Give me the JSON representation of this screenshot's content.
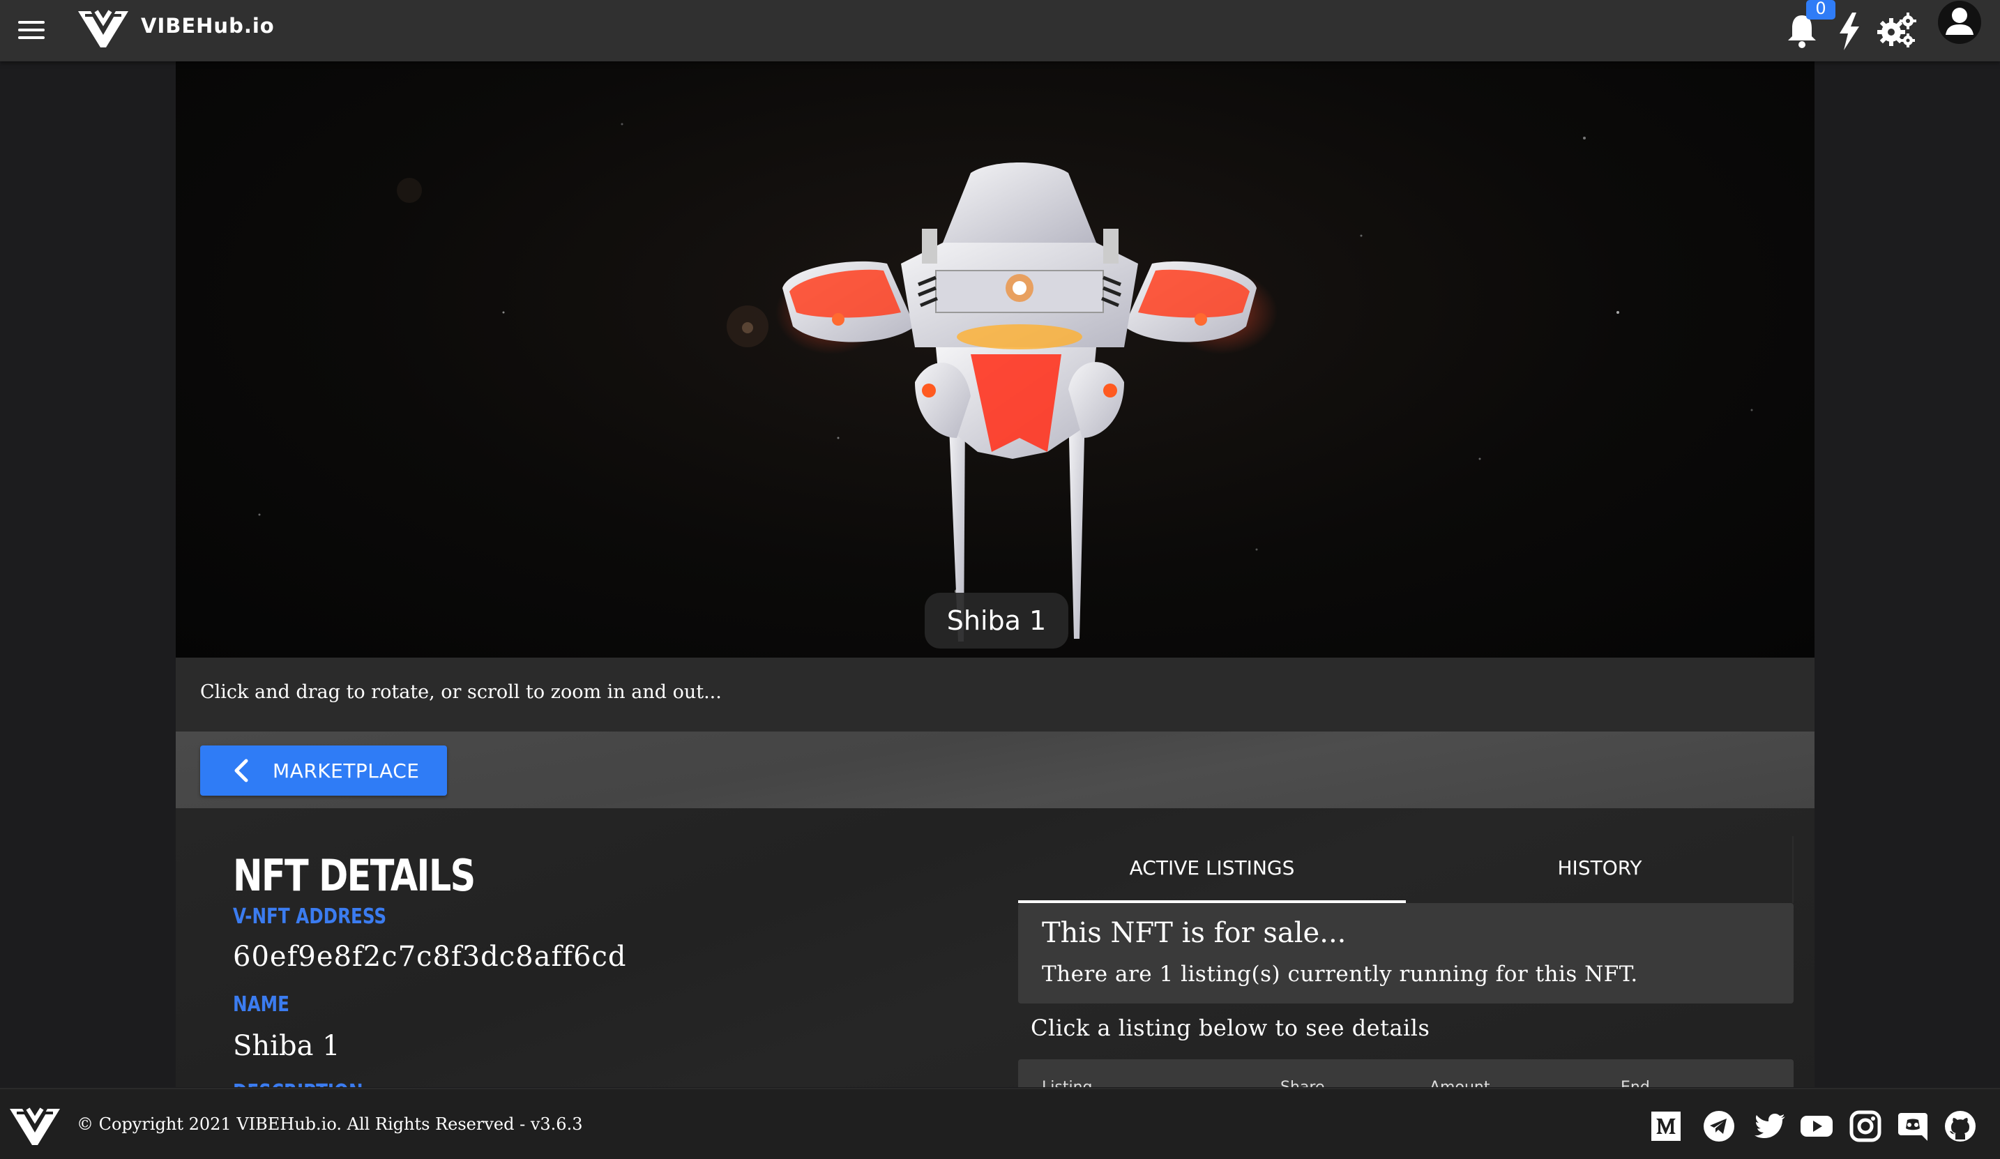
{
  "header": {
    "brand": "VIBEHub.io",
    "notification_count": "0",
    "icons": [
      "menu-icon",
      "bell-icon",
      "lightning-icon",
      "gear-icon",
      "user-icon"
    ]
  },
  "viewer": {
    "model_name": "Shiba 1",
    "hint": "Click and drag to rotate, or scroll to zoom in and out..."
  },
  "nav": {
    "back_label": "MARKETPLACE"
  },
  "details": {
    "title": "NFT DETAILS",
    "address_label": "V-NFT ADDRESS",
    "address_value": "60ef9e8f2c7c8f3dc8aff6cd",
    "name_label": "NAME",
    "name_value": "Shiba 1",
    "description_label": "DESCRIPTION"
  },
  "listings": {
    "tabs": [
      "ACTIVE LISTINGS",
      "HISTORY"
    ],
    "active_tab": "ACTIVE LISTINGS",
    "sale_title": "This NFT is for sale...",
    "sale_subtitle": "There are 1 listing(s) currently running for this NFT.",
    "hint": "Click a listing below to see details",
    "columns": [
      "Listing",
      "Share",
      "Amount",
      "End"
    ]
  },
  "footer": {
    "copyright": "© Copyright 2021 VIBEHub.io. All Rights Reserved - v3.6.3",
    "social_icons": [
      "medium-icon",
      "telegram-icon",
      "twitter-icon",
      "youtube-icon",
      "instagram-icon",
      "discord-icon",
      "github-icon"
    ]
  },
  "colors": {
    "accent": "#2f7cf6",
    "label_blue": "#3b7cf0",
    "topbar": "#303030",
    "background": "#1c1c1e"
  }
}
